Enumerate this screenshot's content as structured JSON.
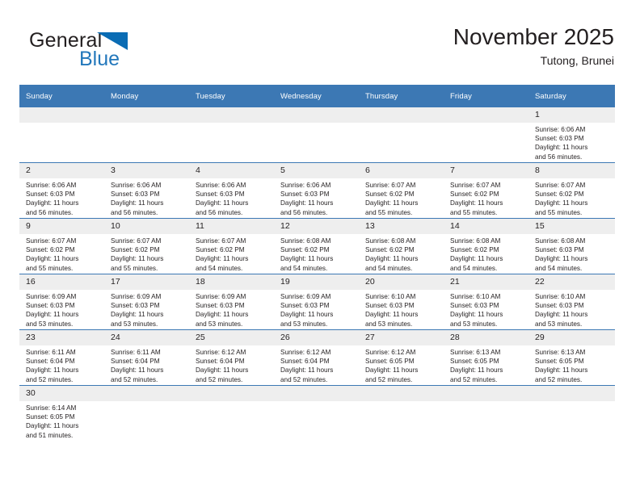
{
  "brand": {
    "name_part1": "General",
    "name_part2": "Blue",
    "flag_color": "#0a6cb4"
  },
  "header": {
    "title": "November 2025",
    "subtitle": "Tutong, Brunei"
  },
  "theme": {
    "header_blue": "#3c78b4",
    "daynum_gray": "#eeeeee",
    "text": "#231f20"
  },
  "weekdays": [
    "Sunday",
    "Monday",
    "Tuesday",
    "Wednesday",
    "Thursday",
    "Friday",
    "Saturday"
  ],
  "weeks": [
    [
      {
        "day": "",
        "empty": true,
        "sunrise": "",
        "sunset": "",
        "daylight1": "",
        "daylight2": ""
      },
      {
        "day": "",
        "empty": true,
        "sunrise": "",
        "sunset": "",
        "daylight1": "",
        "daylight2": ""
      },
      {
        "day": "",
        "empty": true,
        "sunrise": "",
        "sunset": "",
        "daylight1": "",
        "daylight2": ""
      },
      {
        "day": "",
        "empty": true,
        "sunrise": "",
        "sunset": "",
        "daylight1": "",
        "daylight2": ""
      },
      {
        "day": "",
        "empty": true,
        "sunrise": "",
        "sunset": "",
        "daylight1": "",
        "daylight2": ""
      },
      {
        "day": "",
        "empty": true,
        "sunrise": "",
        "sunset": "",
        "daylight1": "",
        "daylight2": ""
      },
      {
        "day": "1",
        "empty": false,
        "sunrise": "Sunrise: 6:06 AM",
        "sunset": "Sunset: 6:03 PM",
        "daylight1": "Daylight: 11 hours",
        "daylight2": "and 56 minutes."
      }
    ],
    [
      {
        "day": "2",
        "empty": false,
        "sunrise": "Sunrise: 6:06 AM",
        "sunset": "Sunset: 6:03 PM",
        "daylight1": "Daylight: 11 hours",
        "daylight2": "and 56 minutes."
      },
      {
        "day": "3",
        "empty": false,
        "sunrise": "Sunrise: 6:06 AM",
        "sunset": "Sunset: 6:03 PM",
        "daylight1": "Daylight: 11 hours",
        "daylight2": "and 56 minutes."
      },
      {
        "day": "4",
        "empty": false,
        "sunrise": "Sunrise: 6:06 AM",
        "sunset": "Sunset: 6:03 PM",
        "daylight1": "Daylight: 11 hours",
        "daylight2": "and 56 minutes."
      },
      {
        "day": "5",
        "empty": false,
        "sunrise": "Sunrise: 6:06 AM",
        "sunset": "Sunset: 6:03 PM",
        "daylight1": "Daylight: 11 hours",
        "daylight2": "and 56 minutes."
      },
      {
        "day": "6",
        "empty": false,
        "sunrise": "Sunrise: 6:07 AM",
        "sunset": "Sunset: 6:02 PM",
        "daylight1": "Daylight: 11 hours",
        "daylight2": "and 55 minutes."
      },
      {
        "day": "7",
        "empty": false,
        "sunrise": "Sunrise: 6:07 AM",
        "sunset": "Sunset: 6:02 PM",
        "daylight1": "Daylight: 11 hours",
        "daylight2": "and 55 minutes."
      },
      {
        "day": "8",
        "empty": false,
        "sunrise": "Sunrise: 6:07 AM",
        "sunset": "Sunset: 6:02 PM",
        "daylight1": "Daylight: 11 hours",
        "daylight2": "and 55 minutes."
      }
    ],
    [
      {
        "day": "9",
        "empty": false,
        "sunrise": "Sunrise: 6:07 AM",
        "sunset": "Sunset: 6:02 PM",
        "daylight1": "Daylight: 11 hours",
        "daylight2": "and 55 minutes."
      },
      {
        "day": "10",
        "empty": false,
        "sunrise": "Sunrise: 6:07 AM",
        "sunset": "Sunset: 6:02 PM",
        "daylight1": "Daylight: 11 hours",
        "daylight2": "and 55 minutes."
      },
      {
        "day": "11",
        "empty": false,
        "sunrise": "Sunrise: 6:07 AM",
        "sunset": "Sunset: 6:02 PM",
        "daylight1": "Daylight: 11 hours",
        "daylight2": "and 54 minutes."
      },
      {
        "day": "12",
        "empty": false,
        "sunrise": "Sunrise: 6:08 AM",
        "sunset": "Sunset: 6:02 PM",
        "daylight1": "Daylight: 11 hours",
        "daylight2": "and 54 minutes."
      },
      {
        "day": "13",
        "empty": false,
        "sunrise": "Sunrise: 6:08 AM",
        "sunset": "Sunset: 6:02 PM",
        "daylight1": "Daylight: 11 hours",
        "daylight2": "and 54 minutes."
      },
      {
        "day": "14",
        "empty": false,
        "sunrise": "Sunrise: 6:08 AM",
        "sunset": "Sunset: 6:02 PM",
        "daylight1": "Daylight: 11 hours",
        "daylight2": "and 54 minutes."
      },
      {
        "day": "15",
        "empty": false,
        "sunrise": "Sunrise: 6:08 AM",
        "sunset": "Sunset: 6:03 PM",
        "daylight1": "Daylight: 11 hours",
        "daylight2": "and 54 minutes."
      }
    ],
    [
      {
        "day": "16",
        "empty": false,
        "sunrise": "Sunrise: 6:09 AM",
        "sunset": "Sunset: 6:03 PM",
        "daylight1": "Daylight: 11 hours",
        "daylight2": "and 53 minutes."
      },
      {
        "day": "17",
        "empty": false,
        "sunrise": "Sunrise: 6:09 AM",
        "sunset": "Sunset: 6:03 PM",
        "daylight1": "Daylight: 11 hours",
        "daylight2": "and 53 minutes."
      },
      {
        "day": "18",
        "empty": false,
        "sunrise": "Sunrise: 6:09 AM",
        "sunset": "Sunset: 6:03 PM",
        "daylight1": "Daylight: 11 hours",
        "daylight2": "and 53 minutes."
      },
      {
        "day": "19",
        "empty": false,
        "sunrise": "Sunrise: 6:09 AM",
        "sunset": "Sunset: 6:03 PM",
        "daylight1": "Daylight: 11 hours",
        "daylight2": "and 53 minutes."
      },
      {
        "day": "20",
        "empty": false,
        "sunrise": "Sunrise: 6:10 AM",
        "sunset": "Sunset: 6:03 PM",
        "daylight1": "Daylight: 11 hours",
        "daylight2": "and 53 minutes."
      },
      {
        "day": "21",
        "empty": false,
        "sunrise": "Sunrise: 6:10 AM",
        "sunset": "Sunset: 6:03 PM",
        "daylight1": "Daylight: 11 hours",
        "daylight2": "and 53 minutes."
      },
      {
        "day": "22",
        "empty": false,
        "sunrise": "Sunrise: 6:10 AM",
        "sunset": "Sunset: 6:03 PM",
        "daylight1": "Daylight: 11 hours",
        "daylight2": "and 53 minutes."
      }
    ],
    [
      {
        "day": "23",
        "empty": false,
        "sunrise": "Sunrise: 6:11 AM",
        "sunset": "Sunset: 6:04 PM",
        "daylight1": "Daylight: 11 hours",
        "daylight2": "and 52 minutes."
      },
      {
        "day": "24",
        "empty": false,
        "sunrise": "Sunrise: 6:11 AM",
        "sunset": "Sunset: 6:04 PM",
        "daylight1": "Daylight: 11 hours",
        "daylight2": "and 52 minutes."
      },
      {
        "day": "25",
        "empty": false,
        "sunrise": "Sunrise: 6:12 AM",
        "sunset": "Sunset: 6:04 PM",
        "daylight1": "Daylight: 11 hours",
        "daylight2": "and 52 minutes."
      },
      {
        "day": "26",
        "empty": false,
        "sunrise": "Sunrise: 6:12 AM",
        "sunset": "Sunset: 6:04 PM",
        "daylight1": "Daylight: 11 hours",
        "daylight2": "and 52 minutes."
      },
      {
        "day": "27",
        "empty": false,
        "sunrise": "Sunrise: 6:12 AM",
        "sunset": "Sunset: 6:05 PM",
        "daylight1": "Daylight: 11 hours",
        "daylight2": "and 52 minutes."
      },
      {
        "day": "28",
        "empty": false,
        "sunrise": "Sunrise: 6:13 AM",
        "sunset": "Sunset: 6:05 PM",
        "daylight1": "Daylight: 11 hours",
        "daylight2": "and 52 minutes."
      },
      {
        "day": "29",
        "empty": false,
        "sunrise": "Sunrise: 6:13 AM",
        "sunset": "Sunset: 6:05 PM",
        "daylight1": "Daylight: 11 hours",
        "daylight2": "and 52 minutes."
      }
    ],
    [
      {
        "day": "30",
        "empty": false,
        "sunrise": "Sunrise: 6:14 AM",
        "sunset": "Sunset: 6:05 PM",
        "daylight1": "Daylight: 11 hours",
        "daylight2": "and 51 minutes."
      },
      {
        "day": "",
        "empty": true,
        "sunrise": "",
        "sunset": "",
        "daylight1": "",
        "daylight2": ""
      },
      {
        "day": "",
        "empty": true,
        "sunrise": "",
        "sunset": "",
        "daylight1": "",
        "daylight2": ""
      },
      {
        "day": "",
        "empty": true,
        "sunrise": "",
        "sunset": "",
        "daylight1": "",
        "daylight2": ""
      },
      {
        "day": "",
        "empty": true,
        "sunrise": "",
        "sunset": "",
        "daylight1": "",
        "daylight2": ""
      },
      {
        "day": "",
        "empty": true,
        "sunrise": "",
        "sunset": "",
        "daylight1": "",
        "daylight2": ""
      },
      {
        "day": "",
        "empty": true,
        "sunrise": "",
        "sunset": "",
        "daylight1": "",
        "daylight2": ""
      }
    ]
  ]
}
